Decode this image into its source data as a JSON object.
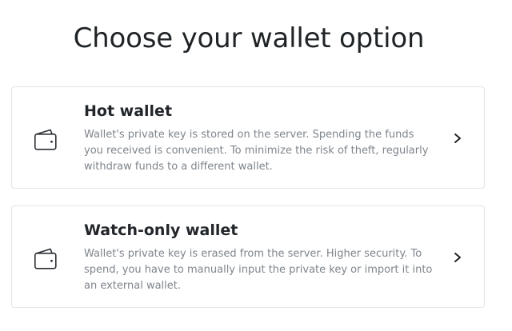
{
  "header": {
    "title": "Choose your wallet option"
  },
  "options": [
    {
      "title": "Hot wallet",
      "description": "Wallet's private key is stored on the server. Spending the funds you received is convenient. To minimize the risk of theft, regularly withdraw funds to a different wallet.",
      "icon": "wallet-icon"
    },
    {
      "title": "Watch-only wallet",
      "description": "Wallet's private key is erased from the server. Higher security. To spend, you have to manually input the private key or import it into an external wallet.",
      "icon": "wallet-icon"
    }
  ],
  "colors": {
    "title": "#1f2326",
    "description": "#7e858c",
    "card_border": "#e2e4e7"
  }
}
